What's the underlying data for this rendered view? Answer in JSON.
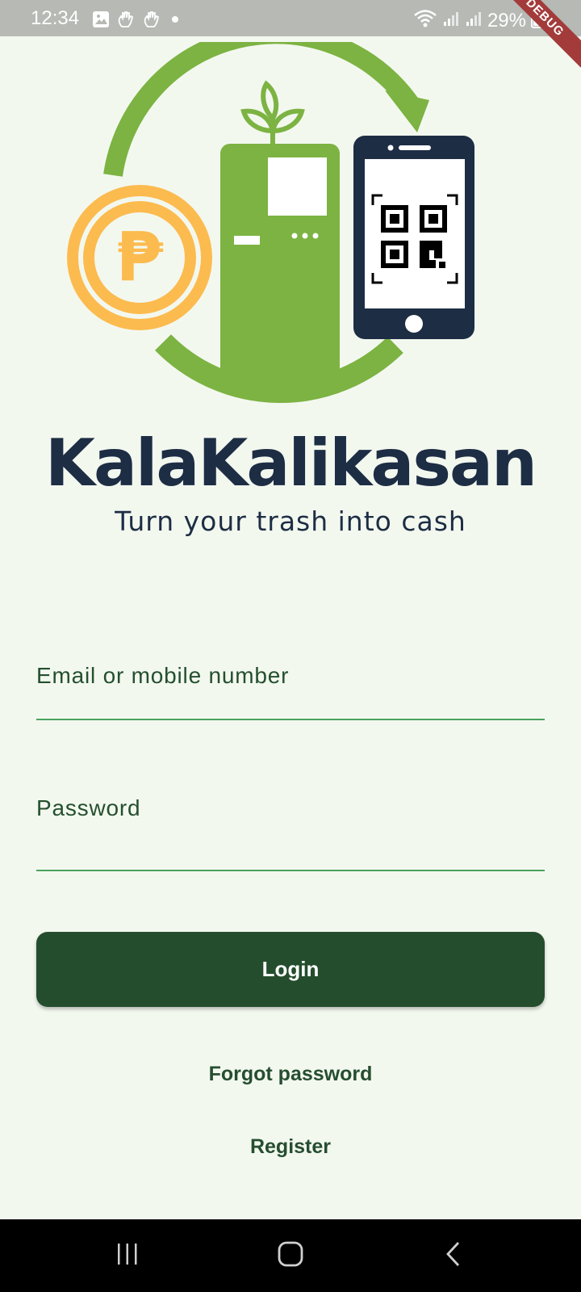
{
  "status_bar": {
    "time": "12:34",
    "battery": "29%",
    "debug_label": "DEBUG"
  },
  "app": {
    "name": "KalaKalikasan",
    "tagline": "Turn your trash into cash",
    "logo_currency_symbol": "₱"
  },
  "form": {
    "email_label": "Email or mobile number",
    "email_value": "",
    "password_label": "Password",
    "password_value": ""
  },
  "actions": {
    "login_label": "Login",
    "forgot_label": "Forgot password",
    "register_label": "Register"
  },
  "colors": {
    "background": "#f3f8ef",
    "primary_button": "#244d2d",
    "brand_green": "#7cb342",
    "brand_navy": "#1d2d44",
    "coin_yellow": "#fcbb4f",
    "field_underline": "#4aa35e"
  },
  "icons": {
    "status_left": [
      "gallery-icon",
      "hand-icon",
      "hand-icon",
      "dot-icon"
    ],
    "status_right": [
      "wifi-icon",
      "signal-icon",
      "signal-icon",
      "battery-icon"
    ],
    "nav": [
      "recents-icon",
      "home-icon",
      "back-icon"
    ]
  }
}
